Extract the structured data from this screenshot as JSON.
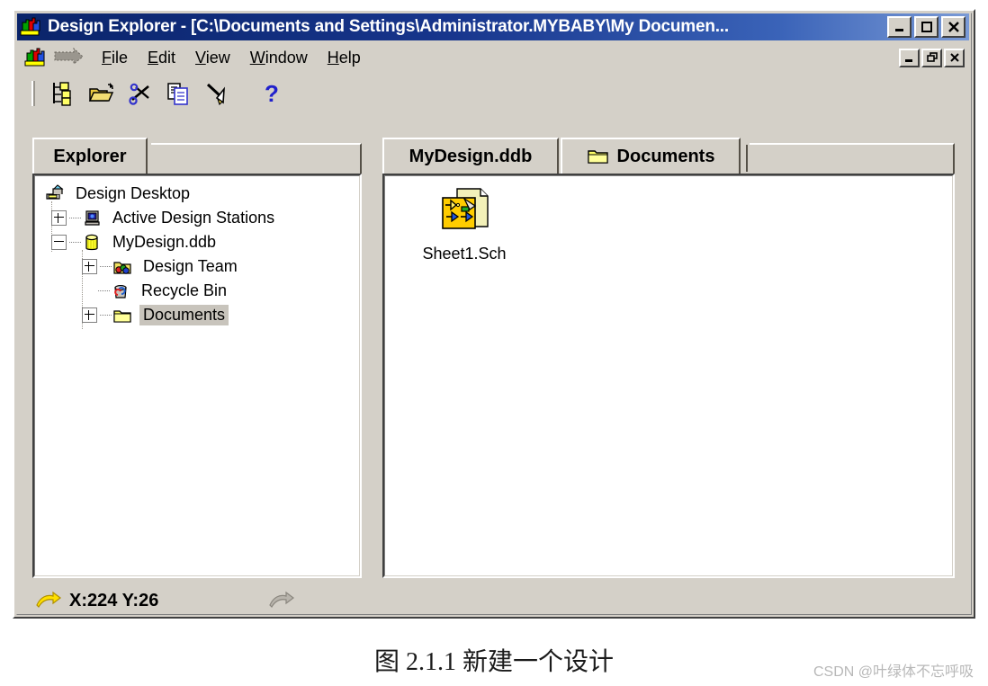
{
  "window": {
    "title": "Design Explorer - [C:\\Documents and Settings\\Administrator.MYBABY\\My Documen...",
    "app_icon": "design-explorer-icon",
    "caption_buttons": [
      {
        "name": "minimize-button",
        "glyph": "minimize"
      },
      {
        "name": "maximize-button",
        "glyph": "maximize"
      },
      {
        "name": "close-button",
        "glyph": "close"
      }
    ],
    "titlebar_color": "#0a246a",
    "face_color": "#d4d0c8"
  },
  "menubar": {
    "doc_icon": "document-icon",
    "restore_arrow_icon": "restore-arrow-icon",
    "items": [
      {
        "name": "menu-file",
        "pre": "",
        "accel": "F",
        "post": "ile"
      },
      {
        "name": "menu-edit",
        "pre": "",
        "accel": "E",
        "post": "dit"
      },
      {
        "name": "menu-view",
        "pre": "",
        "accel": "V",
        "post": "iew"
      },
      {
        "name": "menu-window",
        "pre": "",
        "accel": "W",
        "post": "indow"
      },
      {
        "name": "menu-help",
        "pre": "",
        "accel": "H",
        "post": "elp"
      }
    ],
    "mdi_buttons": [
      {
        "name": "mdi-minimize-button",
        "glyph": "minimize"
      },
      {
        "name": "mdi-restore-button",
        "glyph": "restore"
      },
      {
        "name": "mdi-close-button",
        "glyph": "close"
      }
    ]
  },
  "toolbar": {
    "buttons": [
      {
        "name": "design-hierarchy-button",
        "icon": "hierarchy-tree-icon"
      },
      {
        "name": "open-button",
        "icon": "open-folder-icon"
      },
      {
        "name": "cut-button",
        "icon": "scissors-icon"
      },
      {
        "name": "copy-button",
        "icon": "copy-icon"
      },
      {
        "name": "paste-button",
        "icon": "paste-icon"
      },
      {
        "name": "help-button",
        "icon": "question-mark-icon"
      }
    ]
  },
  "explorer_pane": {
    "tab_label": "Explorer",
    "tree": [
      {
        "name": "tree-item-design-desktop",
        "label": "Design Desktop",
        "icon": "desktop-icon",
        "level": 0,
        "expander": "none",
        "selected": false
      },
      {
        "name": "tree-item-active-design-stations",
        "label": "Active Design Stations",
        "icon": "workstation-icon",
        "level": 1,
        "expander": "plus",
        "selected": false
      },
      {
        "name": "tree-item-mydesign-ddb",
        "label": "MyDesign.ddb",
        "icon": "database-icon",
        "level": 1,
        "expander": "minus",
        "selected": false
      },
      {
        "name": "tree-item-design-team",
        "label": "Design Team",
        "icon": "team-folder-icon",
        "level": 2,
        "expander": "plus",
        "selected": false
      },
      {
        "name": "tree-item-recycle-bin",
        "label": "Recycle Bin",
        "icon": "recycle-bin-icon",
        "level": 2,
        "expander": "none",
        "selected": false
      },
      {
        "name": "tree-item-documents",
        "label": "Documents",
        "icon": "folder-icon",
        "level": 2,
        "expander": "plus",
        "selected": true
      }
    ]
  },
  "documents_pane": {
    "tabs": [
      {
        "name": "tab-mydesign-ddb",
        "label": "MyDesign.ddb",
        "icon": "",
        "active": false
      },
      {
        "name": "tab-documents",
        "label": "Documents",
        "icon": "folder-icon",
        "active": true
      }
    ],
    "files": [
      {
        "name": "file-item-sheet1-sch",
        "label": "Sheet1.Sch",
        "icon": "schematic-document-icon"
      }
    ]
  },
  "statusbar": {
    "left_icon": "yellow-arrow-icon",
    "coordinates": "X:224 Y:26",
    "right_icon": "gray-arrow-icon"
  },
  "figure": {
    "caption": "图 2.1.1 新建一个设计",
    "watermark": "CSDN @叶绿体不忘呼吸"
  }
}
